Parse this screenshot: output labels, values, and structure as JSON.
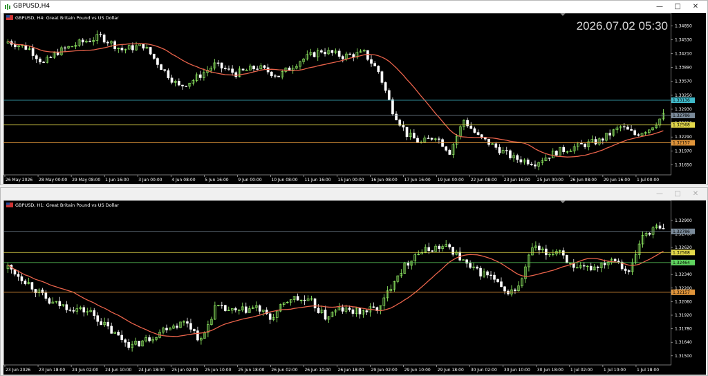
{
  "windows": [
    {
      "title": "GBPUSD,H4",
      "symbol_label": "GBPUSD, H4:  Great Britain Pound vs US Dollar",
      "clock": "2026.07.02 05:30",
      "price_ticks": [
        "1.34850",
        "1.34530",
        "1.34210",
        "1.33890",
        "1.33570",
        "1.33250",
        "1.32930",
        "1.32610",
        "1.32290",
        "1.31970",
        "1.31650"
      ],
      "time_ticks": [
        "26 May 2026",
        "28 May 00:00",
        "29 May 08:00",
        "1 Jun 16:00",
        "3 Jun 00:00",
        "4 Jun 08:00",
        "5 Jun 16:00",
        "9 Jun 00:00",
        "10 Jun 08:00",
        "11 Jun 16:00",
        "15 Jun 00:00",
        "16 Jun 08:00",
        "17 Jun 16:00",
        "19 Jun 00:00",
        "22 Jun 08:00",
        "23 Jun 16:00",
        "25 Jun 00:00",
        "26 Jun 08:00",
        "29 Jun 16:00",
        "1 Jul 00:00"
      ],
      "price_range": [
        1.3145,
        1.3495
      ],
      "hlines": [
        {
          "price": 1.33136,
          "label": "1.33136",
          "color": "#3fb8c8"
        },
        {
          "price": 1.32786,
          "label": "1.32786",
          "color": "#7a8a99"
        },
        {
          "price": 1.32568,
          "label": "1.32568",
          "color": "#e3d84a"
        },
        {
          "price": 1.32157,
          "label": "1.32157",
          "color": "#e0943a"
        }
      ],
      "start": 1.3445,
      "end": 1.3279,
      "waypoints": [
        [
          0,
          1.3449
        ],
        [
          6,
          1.3432
        ],
        [
          10,
          1.3398
        ],
        [
          14,
          1.3425
        ],
        [
          20,
          1.3445
        ],
        [
          26,
          1.346
        ],
        [
          32,
          1.343
        ],
        [
          38,
          1.344
        ],
        [
          44,
          1.338
        ],
        [
          48,
          1.3345
        ],
        [
          52,
          1.336
        ],
        [
          58,
          1.3395
        ],
        [
          64,
          1.3375
        ],
        [
          70,
          1.339
        ],
        [
          76,
          1.337
        ],
        [
          82,
          1.3405
        ],
        [
          88,
          1.3428
        ],
        [
          94,
          1.3415
        ],
        [
          100,
          1.3422
        ],
        [
          104,
          1.338
        ],
        [
          108,
          1.329
        ],
        [
          112,
          1.3235
        ],
        [
          116,
          1.3215
        ],
        [
          120,
          1.3232
        ],
        [
          124,
          1.3195
        ],
        [
          128,
          1.3268
        ],
        [
          132,
          1.323
        ],
        [
          136,
          1.321
        ],
        [
          142,
          1.318
        ],
        [
          148,
          1.317
        ],
        [
          154,
          1.3195
        ],
        [
          160,
          1.3208
        ],
        [
          166,
          1.322
        ],
        [
          172,
          1.3252
        ],
        [
          176,
          1.3235
        ],
        [
          180,
          1.3248
        ],
        [
          184,
          1.3278
        ]
      ],
      "n": 185,
      "ma_period": 20,
      "seed": 7,
      "vol": 0.0018
    },
    {
      "title": "",
      "symbol_label": "GBPUSD, H1:  Great Britain Pound vs US Dollar",
      "clock": "",
      "price_ticks": [
        "1.32900",
        "1.32620",
        "1.32340",
        "1.32060",
        "1.31780",
        "1.31500"
      ],
      "extra_ticks": [
        "1.32760",
        "1.32200",
        "1.31920",
        "1.31640"
      ],
      "time_ticks": [
        "23 Jun 2026",
        "23 Jun 18:00",
        "24 Jun 02:00",
        "24 Jun 10:00",
        "24 Jun 18:00",
        "25 Jun 02:00",
        "25 Jun 10:00",
        "25 Jun 18:00",
        "26 Jun 02:00",
        "26 Jun 10:00",
        "26 Jun 18:00",
        "29 Jun 02:00",
        "29 Jun 10:00",
        "29 Jun 18:00",
        "30 Jun 02:00",
        "30 Jun 10:00",
        "30 Jun 18:00",
        "1 Jul 02:00",
        "1 Jul 10:00",
        "1 Jul 18:00"
      ],
      "price_range": [
        1.3142,
        1.3302
      ],
      "hlines": [
        {
          "price": 1.32786,
          "label": "1.32786",
          "color": "#7a8a99"
        },
        {
          "price": 1.32568,
          "label": "1.32568",
          "color": "#e3d84a"
        },
        {
          "price": 1.32464,
          "label": "1.32464",
          "color": "#5fd35f"
        },
        {
          "price": 1.32157,
          "label": "1.32157",
          "color": "#e0943a"
        }
      ],
      "start": 1.324,
      "end": 1.3279,
      "waypoints": [
        [
          0,
          1.3242
        ],
        [
          6,
          1.3225
        ],
        [
          12,
          1.3205
        ],
        [
          18,
          1.32
        ],
        [
          24,
          1.3195
        ],
        [
          30,
          1.3175
        ],
        [
          36,
          1.316
        ],
        [
          42,
          1.317
        ],
        [
          46,
          1.318
        ],
        [
          52,
          1.3185
        ],
        [
          56,
          1.3165
        ],
        [
          60,
          1.32
        ],
        [
          66,
          1.3195
        ],
        [
          72,
          1.32
        ],
        [
          76,
          1.3188
        ],
        [
          82,
          1.321
        ],
        [
          88,
          1.3205
        ],
        [
          92,
          1.319
        ],
        [
          96,
          1.3198
        ],
        [
          102,
          1.3195
        ],
        [
          108,
          1.32
        ],
        [
          112,
          1.323
        ],
        [
          118,
          1.3255
        ],
        [
          124,
          1.3262
        ],
        [
          128,
          1.3262
        ],
        [
          134,
          1.324
        ],
        [
          140,
          1.3232
        ],
        [
          144,
          1.3215
        ],
        [
          148,
          1.322
        ],
        [
          152,
          1.3262
        ],
        [
          156,
          1.3255
        ],
        [
          160,
          1.326
        ],
        [
          164,
          1.3238
        ],
        [
          170,
          1.3242
        ],
        [
          176,
          1.3252
        ],
        [
          180,
          1.3235
        ],
        [
          184,
          1.3275
        ],
        [
          188,
          1.3282
        ],
        [
          190,
          1.3279
        ]
      ],
      "n": 191,
      "ma_period": 20,
      "seed": 13,
      "vol": 0.0009
    }
  ],
  "colors": {
    "bull": "#9cff6b",
    "bear": "#ffffff",
    "ma": "#e8624a",
    "background": "#000000",
    "grid_text": "#ffffff"
  },
  "icons": [
    "chart-window-icon",
    "minimize-icon",
    "maximize-icon",
    "close-icon",
    "flag-icon"
  ]
}
